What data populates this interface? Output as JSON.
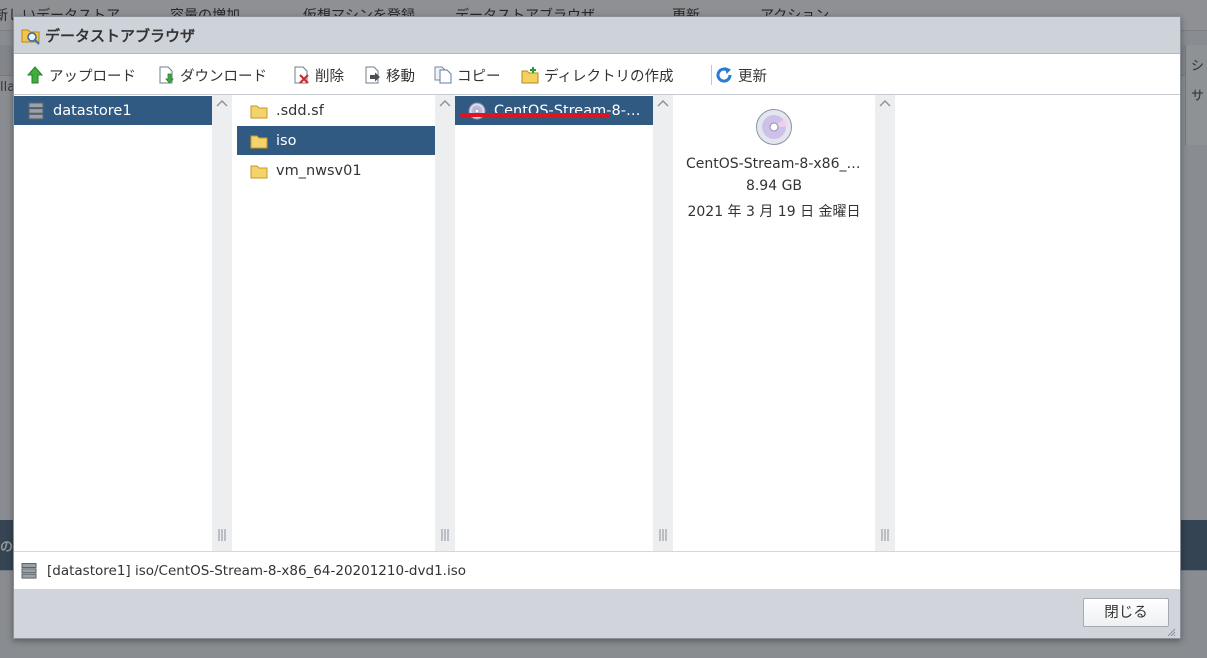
{
  "background": {
    "toolbar_items": [
      "新しいデータストア",
      "容量の増加",
      "仮想マシンを登録",
      "データストアブラウザ",
      "更新",
      "アクション"
    ],
    "right_column": [
      "シ",
      "サ"
    ],
    "fragments": [
      "lla",
      "の"
    ]
  },
  "dialog": {
    "title": "データストアブラウザ",
    "toolbar": {
      "upload": "アップロード",
      "download": "ダウンロード",
      "delete": "削除",
      "move": "移動",
      "copy": "コピー",
      "mkdir": "ディレクトリの作成",
      "refresh": "更新"
    },
    "panes": {
      "datastores": [
        "datastore1"
      ],
      "folders": [
        ".sdd.sf",
        "iso",
        "vm_nwsv01"
      ],
      "files": [
        "CentOS-Stream-8-x86_64-20201210-dvd1.iso"
      ]
    },
    "selected": {
      "datastore": "datastore1",
      "folder": "iso",
      "file": "CentOS-Stream-8-x86_64-20201210-dvd1.iso"
    },
    "details": {
      "name": "CentOS-Stream-8-x86_64-20201210-dvd1.iso",
      "size": "8.94 GB",
      "date": "2021 年 3 月 19 日 金曜日"
    },
    "status_path": "[datastore1] iso/CentOS-Stream-8-x86_64-20201210-dvd1.iso",
    "close_label": "閉じる"
  },
  "colors": {
    "selection": "#315a82",
    "annotation_underline": "#e0141e"
  }
}
